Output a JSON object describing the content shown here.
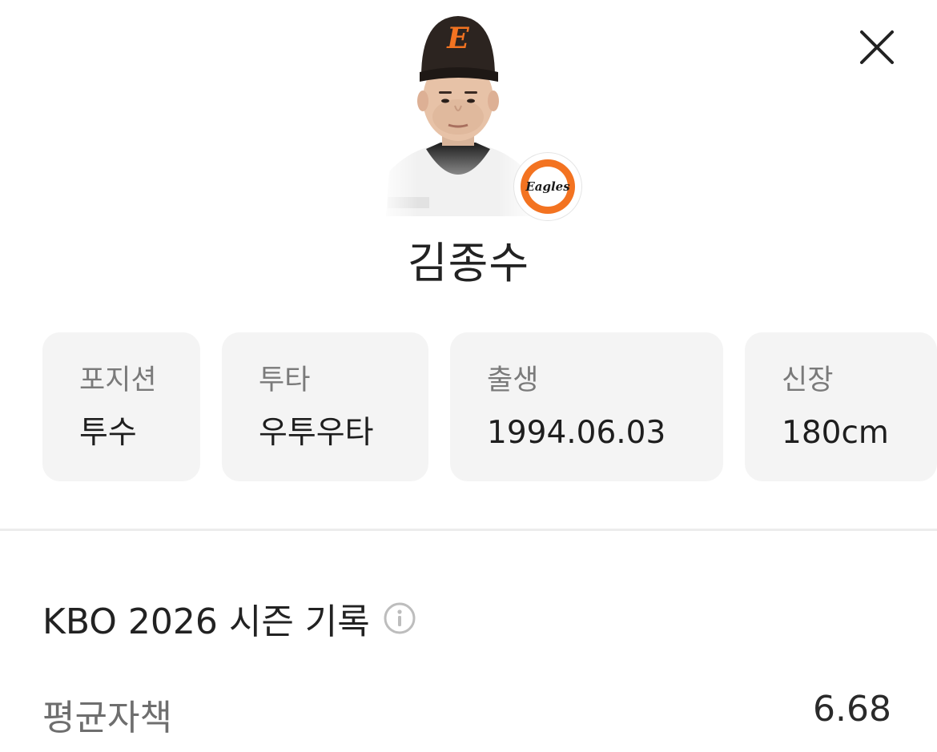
{
  "header": {
    "close_icon": "close-icon"
  },
  "player": {
    "name": "김종수",
    "photo_icon": "player-photo",
    "team_logo_text": "Eagles",
    "team_color": "#f37321"
  },
  "profile_cards": [
    {
      "label": "포지션",
      "value": "투수"
    },
    {
      "label": "투타",
      "value": "우투우타"
    },
    {
      "label": "출생",
      "value": "1994.06.03"
    },
    {
      "label": "신장",
      "value": "180cm"
    }
  ],
  "season": {
    "title": "KBO 2026 시즌 기록",
    "info_icon": "info-icon",
    "stats": [
      {
        "label": "평균자책",
        "value": "6.68"
      }
    ]
  }
}
